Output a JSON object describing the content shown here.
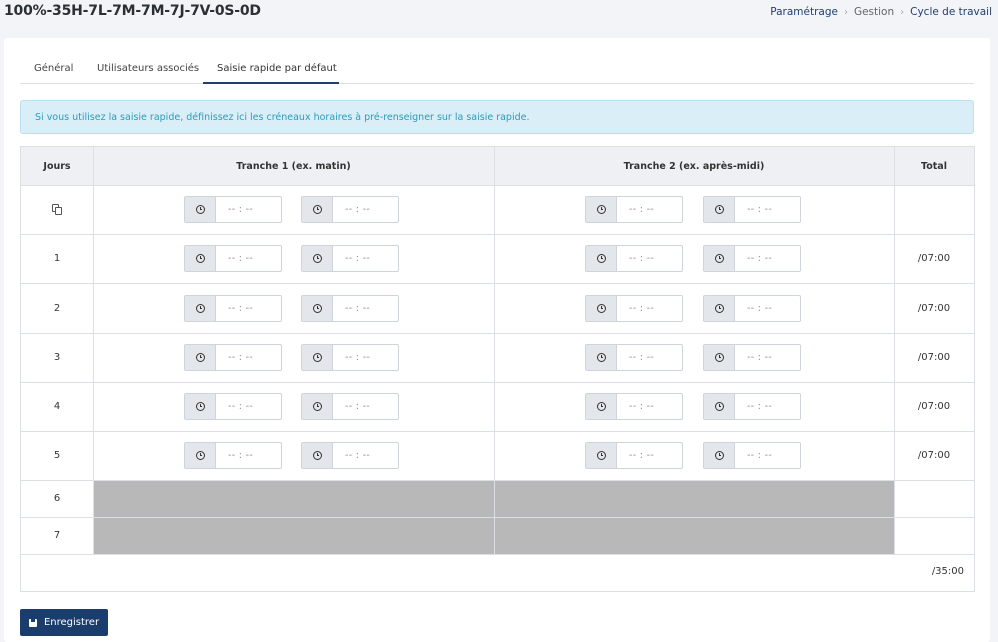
{
  "header": {
    "title": "100%-35H-7L-7M-7M-7J-7V-0S-0D",
    "breadcrumb": [
      "Paramétrage",
      "Gestion",
      "Cycle de travail"
    ]
  },
  "tabs": [
    "Général",
    "Utilisateurs associés",
    "Saisie rapide par défaut"
  ],
  "active_tab": "Saisie rapide par défaut",
  "alert": "Si vous utilisez la saisie rapide, définissez ici les créneaux horaires à pré-renseigner sur la saisie rapide.",
  "table": {
    "headers": {
      "days": "Jours",
      "slot1": "Tranche 1 (ex. matin)",
      "slot2": "Tranche 2 (ex. après-midi)",
      "total": "Total"
    },
    "time_placeholder": "-- : --",
    "rows": [
      {
        "day": "1",
        "total": "/07:00"
      },
      {
        "day": "2",
        "total": "/07:00"
      },
      {
        "day": "3",
        "total": "/07:00"
      },
      {
        "day": "4",
        "total": "/07:00"
      },
      {
        "day": "5",
        "total": "/07:00"
      },
      {
        "day": "6",
        "total": ""
      },
      {
        "day": "7",
        "total": ""
      }
    ],
    "grand_total": "/35:00"
  },
  "save_label": "Enregistrer",
  "colors": {
    "primary": "#1b3d6d",
    "alert_bg": "#d9eef6",
    "alert_text": "#2a9cbc",
    "disabled": "#b8b8b8"
  }
}
